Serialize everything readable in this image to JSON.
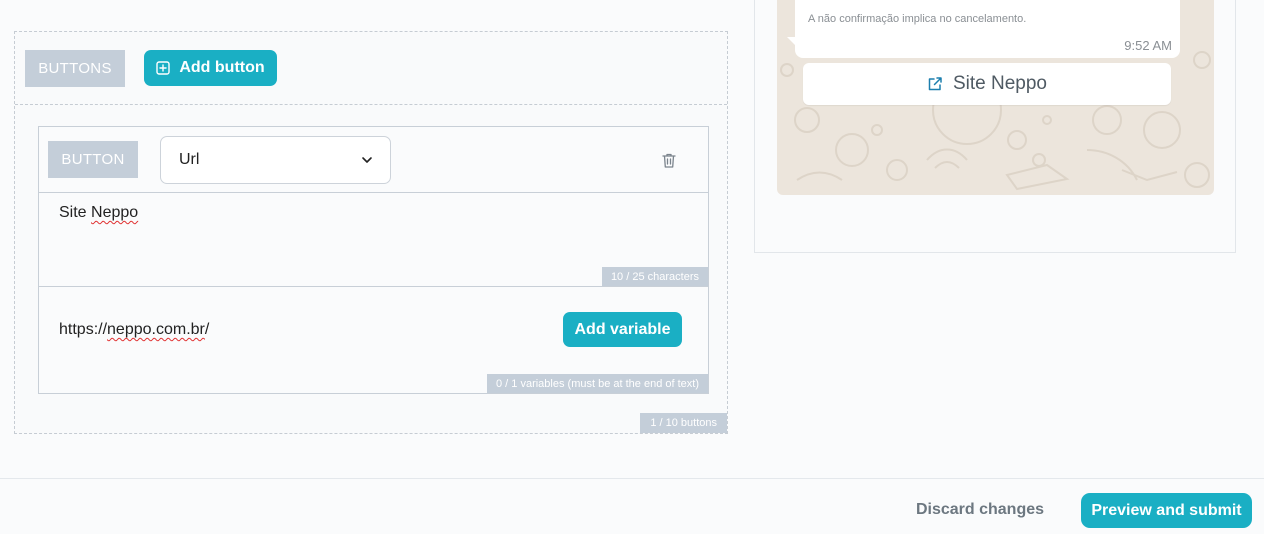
{
  "buttons_section": {
    "tag": "BUTTONS",
    "add_button_label": "Add button",
    "counter": "1 / 10 buttons",
    "button_card": {
      "tag": "BUTTON",
      "type_selected": "Url",
      "text_prefix": "Site ",
      "text_misspelled": "Neppo",
      "text_counter": "10 / 25 characters",
      "url_prefix": "https://",
      "url_misspelled": "neppo.com.br",
      "url_suffix": "/",
      "add_variable_label": "Add variable",
      "variables_counter": "0 / 1 variables (must be at the end of text)"
    }
  },
  "preview": {
    "message_text": "A não confirmação implica no cancelamento.",
    "time": "9:52 AM",
    "link_button_label": "Site Neppo"
  },
  "footer": {
    "discard_label": "Discard changes",
    "submit_label": "Preview and submit"
  },
  "colors": {
    "accent": "#1aafc4",
    "tag_bg": "#c4ced9",
    "chat_bg": "#ece5dc"
  },
  "icons": {
    "add_button": "plus-square-icon",
    "type_select": "chevron-down-icon",
    "delete": "trash-icon",
    "link_button": "external-link-icon"
  }
}
